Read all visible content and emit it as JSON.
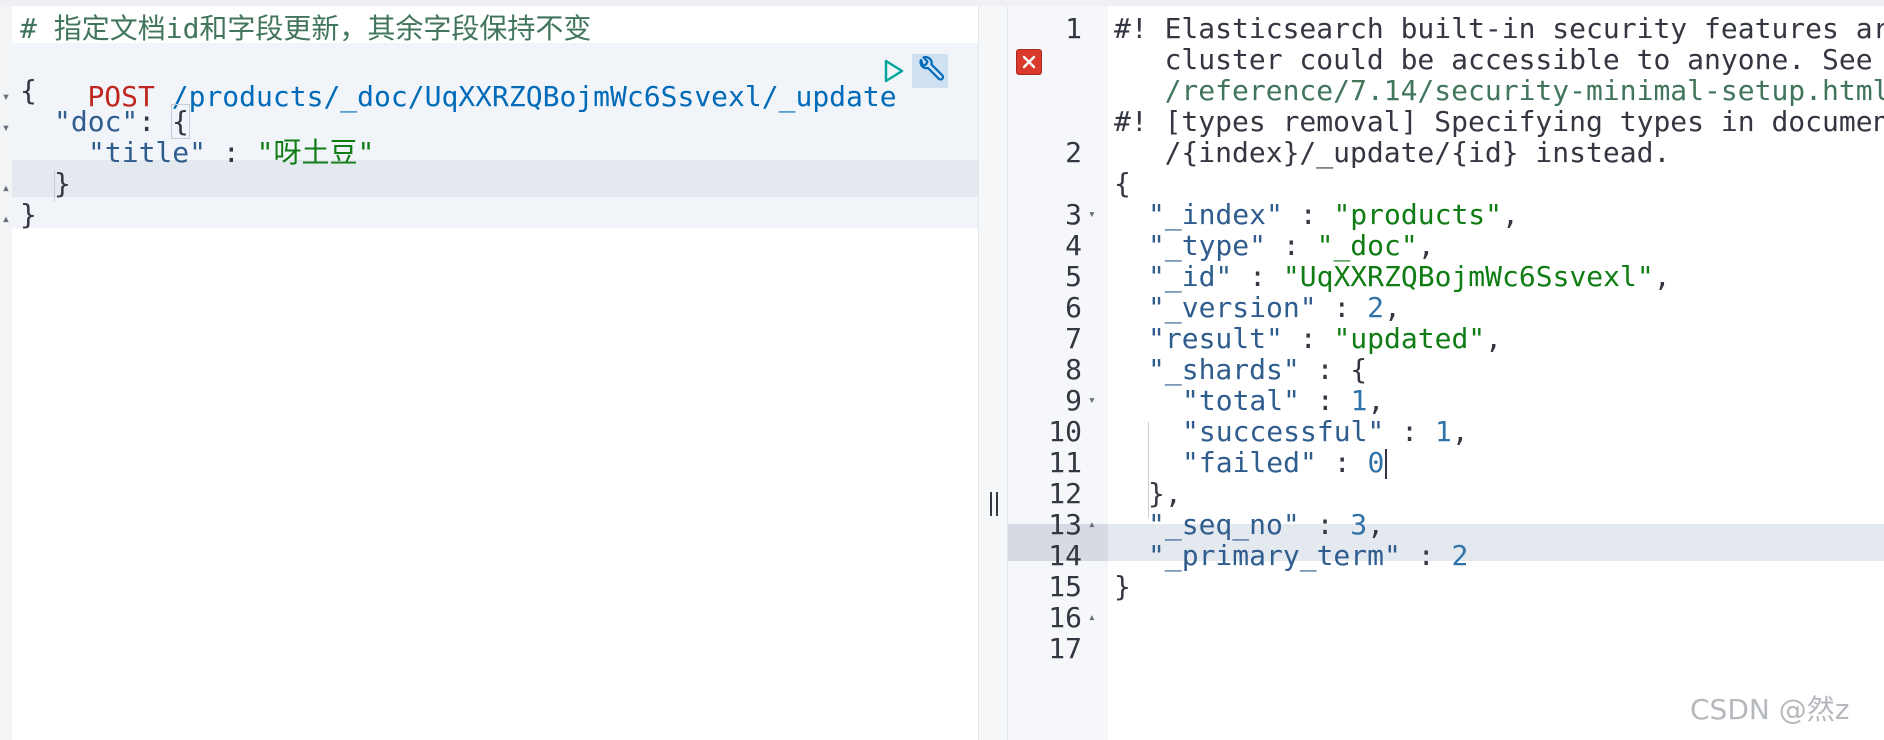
{
  "request": {
    "comment": "# 指定文档id和字段更新，其余字段保持不变",
    "method": "POST",
    "url": "/products/_doc/UqXXRZQBojmWc6Ssvexl/_update",
    "body": {
      "open_brace": "{",
      "doc_key": "\"doc\"",
      "doc_sep": ": ",
      "doc_open": "{",
      "title_key": "\"title\"",
      "title_sep": " : ",
      "title_value": "\"呀土豆\"",
      "doc_close": "}",
      "close_brace": "}"
    }
  },
  "response": {
    "line_numbers": [
      "1",
      "2",
      "3",
      "4",
      "5",
      "6",
      "7",
      "8",
      "9",
      "10",
      "11",
      "12",
      "13",
      "14",
      "15",
      "16",
      "17"
    ],
    "warning1": [
      "#! Elasticsearch built-in security features ar",
      "   cluster could be accessible to anyone. See h",
      "   /reference/7.14/security-minimal-setup.html"
    ],
    "warning2": [
      "#! [types removal] Specifying types in documen",
      "   /{index}/_update/{id} instead."
    ],
    "open_brace": "{",
    "index_key": "\"_index\"",
    "index_val": "\"products\"",
    "type_key": "\"_type\"",
    "type_val": "\"_doc\"",
    "id_key": "\"_id\"",
    "id_val": "\"UqXXRZQBojmWc6Ssvexl\"",
    "version_key": "\"_version\"",
    "version_val": "2",
    "result_key": "\"result\"",
    "result_val": "\"updated\"",
    "shards_key": "\"_shards\"",
    "shards_open": "{",
    "total_key": "\"total\"",
    "total_val": "1",
    "successful_key": "\"successful\"",
    "successful_val": "1",
    "failed_key": "\"failed\"",
    "failed_val": "0",
    "shards_close": "},",
    "seq_key": "\"_seq_no\"",
    "seq_val": "3",
    "term_key": "\"_primary_term\"",
    "term_val": "2",
    "close_brace": "}"
  },
  "watermark": "CSDN @然z",
  "icons": {
    "run": "play-icon",
    "settings": "wrench-icon",
    "error": "error-icon",
    "fold": "fold-arrow-icon",
    "resize": "resize-handle-icon"
  },
  "colors": {
    "comment": "#41755c",
    "method": "#bd271e",
    "url": "#006bb8",
    "string": "#0f7c14",
    "number": "#2f73a8",
    "error": "#d93a2b",
    "run": "#00a69b"
  }
}
